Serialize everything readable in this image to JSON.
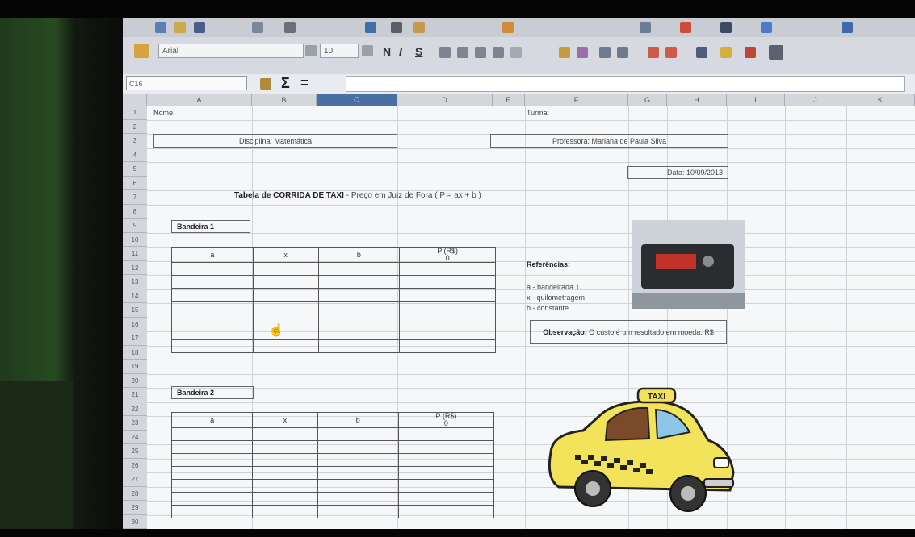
{
  "toolbar": {
    "font_name": "Arial",
    "font_size": "10",
    "bold_label": "N",
    "italic_label": "I",
    "underline_label": "S"
  },
  "formula_bar": {
    "cell_ref": "C16",
    "sum_symbol": "Σ",
    "equals_symbol": "="
  },
  "columns": [
    "A",
    "B",
    "C",
    "D",
    "E",
    "F",
    "G",
    "H",
    "I",
    "J",
    "K"
  ],
  "rows": [
    "1",
    "2",
    "3",
    "4",
    "5",
    "6",
    "7",
    "8",
    "9",
    "10",
    "11",
    "12",
    "13",
    "14",
    "15",
    "16",
    "17",
    "18",
    "19",
    "20",
    "21",
    "22",
    "23",
    "24",
    "25",
    "26",
    "27",
    "28",
    "29",
    "30"
  ],
  "sheet": {
    "nome_label": "Nome:",
    "turma_label": "Turma:",
    "disciplina": "Disciplina: Matemática",
    "professora": "Professora: Mariana de Paula Silva",
    "data": "Data: 10/09/2013",
    "titulo_bold": "Tabela de CORRIDA DE TAXI",
    "titulo_rest": " - Preço em Juiz de Fora  ( P = ax + b )",
    "bandeira1": "Bandeira 1",
    "bandeira2": "Bandeira 2",
    "table_headers": [
      "a",
      "x",
      "b",
      "P (R$)"
    ],
    "table_header_sub": "0",
    "referencias_title": "Referências:",
    "ref_a": "a - bandeirada 1",
    "ref_x": "x - quilometragem",
    "ref_b": "b - constante",
    "observacao_bold": "Observação:",
    "observacao_text": "O custo é um resultado em moeda: R$",
    "taxi_sign": "TAXI"
  },
  "colors": {
    "taxi_yellow": "#f2e35a",
    "taxi_outline": "#222222",
    "selected_column": "#4a6fa5"
  }
}
